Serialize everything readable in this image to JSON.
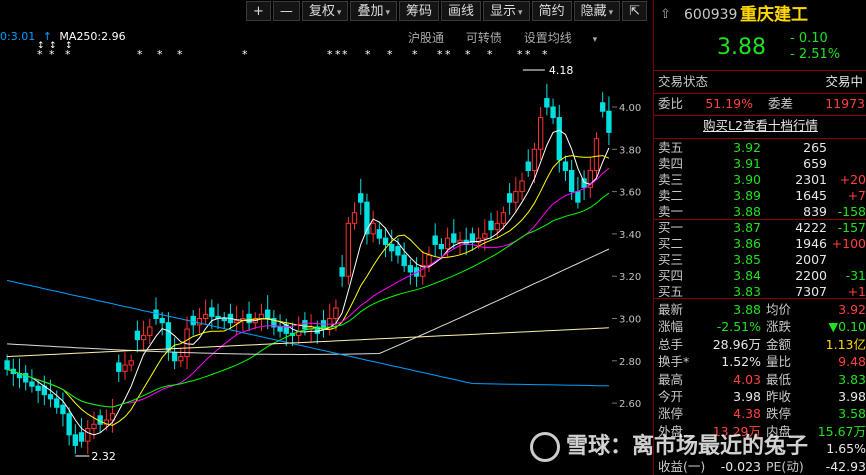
{
  "toolbar": {
    "items": [
      {
        "label": "+",
        "name": "zoom-in-button"
      },
      {
        "label": "—",
        "name": "zoom-out-button"
      },
      {
        "label": "复权",
        "name": "fuquan-button",
        "dropdown": true
      },
      {
        "label": "叠加",
        "name": "overlay-button",
        "dropdown": true
      },
      {
        "label": "筹码",
        "name": "chips-button"
      },
      {
        "label": "画线",
        "name": "draw-line-button"
      },
      {
        "label": "显示",
        "name": "display-button",
        "dropdown": true
      },
      {
        "label": "简约",
        "name": "simple-button"
      },
      {
        "label": "隐藏",
        "name": "hide-button",
        "dropdown": true
      },
      {
        "label": "⇱",
        "name": "fullscreen-button"
      }
    ]
  },
  "ma_legend": {
    "ma_left": "0:3.01",
    "ma250": "MA250:2.96"
  },
  "sublinks": {
    "hgt": "沪股通",
    "convertible": "可转债",
    "set_ma": "设置均线"
  },
  "axis": {
    "ticks": [
      "4.00",
      "3.80",
      "3.60",
      "3.40",
      "3.20",
      "3.00",
      "2.80",
      "2.60"
    ]
  },
  "annotations": {
    "high": "4.18",
    "low": "2.32"
  },
  "colors": {
    "up": "#ff3030",
    "down": "#00e0e0",
    "ma5": "#ffffff",
    "ma10": "#ffff00",
    "ma20": "#ff00ff",
    "ma30": "#00ff00",
    "ma60": "#dcdcdc",
    "ma120": "#00a0ff"
  },
  "quote": {
    "code": "600939",
    "name": "重庆建工",
    "price": "3.88",
    "change": "- 0.10",
    "change_pct": "- 2.51%"
  },
  "status": {
    "label": "交易状态",
    "value": "交易中"
  },
  "ratio": {
    "weibi_label": "委比",
    "weibi": "51.19%",
    "weicha_label": "委差",
    "weicha": "11973"
  },
  "l2_link": "购买L2查看十档行情",
  "asks": [
    {
      "label": "卖五",
      "price": "3.92",
      "vol": "265",
      "delta": ""
    },
    {
      "label": "卖四",
      "price": "3.91",
      "vol": "659",
      "delta": ""
    },
    {
      "label": "卖三",
      "price": "3.90",
      "vol": "2301",
      "delta": "+20"
    },
    {
      "label": "卖二",
      "price": "3.89",
      "vol": "1645",
      "delta": "+7"
    },
    {
      "label": "卖一",
      "price": "3.88",
      "vol": "839",
      "delta": "-158"
    }
  ],
  "bids": [
    {
      "label": "买一",
      "price": "3.87",
      "vol": "4222",
      "delta": "-157"
    },
    {
      "label": "买二",
      "price": "3.86",
      "vol": "1946",
      "delta": "+100"
    },
    {
      "label": "买三",
      "price": "3.85",
      "vol": "2007",
      "delta": ""
    },
    {
      "label": "买四",
      "price": "3.84",
      "vol": "2200",
      "delta": "-31"
    },
    {
      "label": "买五",
      "price": "3.83",
      "vol": "7307",
      "delta": "+1"
    }
  ],
  "stats": [
    {
      "l1": "最新",
      "v1": "3.88",
      "c1": "green",
      "l2": "均价",
      "v2": "3.92",
      "c2": "red"
    },
    {
      "l1": "涨幅",
      "v1": "-2.51%",
      "c1": "green",
      "l2": "涨跌",
      "v2": "▼0.10",
      "c2": "green"
    },
    {
      "l1": "总手",
      "v1": "28.96万",
      "c1": "white",
      "l2": "金额",
      "v2": "1.13亿",
      "c2": "yellow"
    },
    {
      "l1": "换手*",
      "v1": "1.52%",
      "c1": "white",
      "l2": "量比",
      "v2": "9.48",
      "c2": "red"
    },
    {
      "l1": "最高",
      "v1": "4.03",
      "c1": "red",
      "l2": "最低",
      "v2": "3.83",
      "c2": "green"
    },
    {
      "l1": "今开",
      "v1": "3.98",
      "c1": "white",
      "l2": "昨收",
      "v2": "3.98",
      "c2": "white"
    },
    {
      "l1": "涨停",
      "v1": "4.38",
      "c1": "red",
      "l2": "跌停",
      "v2": "3.58",
      "c2": "green"
    },
    {
      "l1": "外盘",
      "v1": "13.29万",
      "c1": "red",
      "l2": "内盘",
      "v2": "15.67万",
      "c2": "green"
    },
    {
      "l1": "",
      "v1": "",
      "c1": "white",
      "l2": "",
      "v2": "1.65%",
      "c2": "white"
    },
    {
      "l1": "收益(一)",
      "v1": "-0.023",
      "c1": "white",
      "l2": "PE(动)",
      "v2": "-42.93",
      "c2": "white"
    }
  ],
  "watermark": {
    "brand": "雪球",
    "author": "离市场最近的兔子"
  }
}
